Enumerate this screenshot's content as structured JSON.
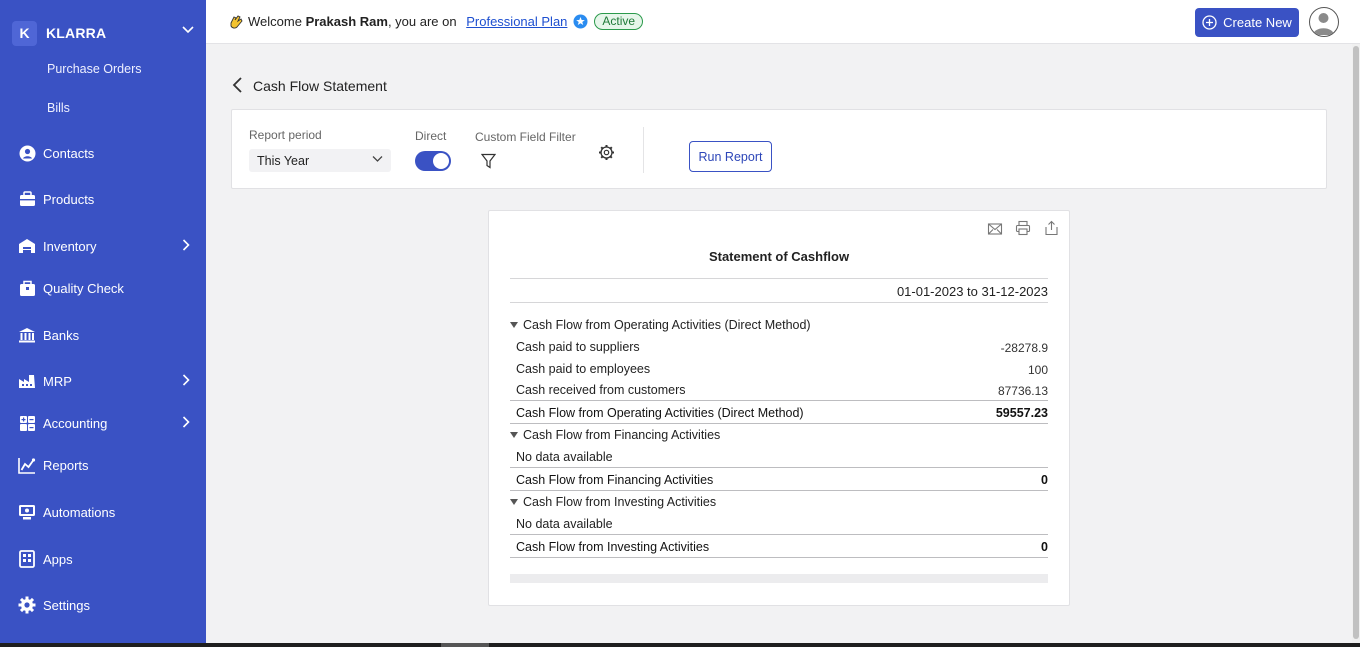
{
  "sidebar": {
    "org_initial": "K",
    "org_name": "KLARRA",
    "sub_items": [
      "Purchase Orders",
      "Bills"
    ],
    "items": [
      {
        "label": "Contacts",
        "icon": "contacts-icon"
      },
      {
        "label": "Products",
        "icon": "products-icon"
      },
      {
        "label": "Inventory",
        "icon": "inventory-icon",
        "has_children": true
      },
      {
        "label": "Quality Check",
        "icon": "quality-check-icon"
      },
      {
        "label": "Banks",
        "icon": "bank-icon"
      },
      {
        "label": "MRP",
        "icon": "factory-icon",
        "has_children": true
      },
      {
        "label": "Accounting",
        "icon": "accounting-icon",
        "has_children": true
      },
      {
        "label": "Reports",
        "icon": "reports-icon"
      },
      {
        "label": "Automations",
        "icon": "automations-icon"
      },
      {
        "label": "Apps",
        "icon": "apps-icon"
      },
      {
        "label": "Settings",
        "icon": "gear-icon"
      }
    ]
  },
  "topbar": {
    "welcome_prefix": "Welcome ",
    "user_name": "Prakash Ram",
    "welcome_suffix": ", you are on ",
    "plan": "Professional Plan",
    "status": "Active",
    "create_label": "Create New"
  },
  "page": {
    "title": "Cash Flow Statement"
  },
  "filters": {
    "period_label": "Report period",
    "period_value": "This Year",
    "direct_label": "Direct",
    "direct_on": true,
    "custom_filter_label": "Custom Field Filter",
    "run_label": "Run Report"
  },
  "report": {
    "title": "Statement of Cashflow",
    "date_range": "01-01-2023 to 31-12-2023",
    "sections": [
      {
        "heading": "Cash Flow from Operating Activities (Direct Method)",
        "rows": [
          {
            "label": "Cash paid to suppliers",
            "value": "-28278.9"
          },
          {
            "label": "Cash paid to employees",
            "value": "100"
          },
          {
            "label": "Cash received from customers",
            "value": "87736.13"
          }
        ],
        "total_label": "Cash Flow from Operating Activities (Direct Method)",
        "total_value": "59557.23"
      },
      {
        "heading": "Cash Flow from Financing Activities",
        "rows": [
          {
            "label": "No data available",
            "value": ""
          }
        ],
        "total_label": "Cash Flow from Financing Activities",
        "total_value": "0"
      },
      {
        "heading": "Cash Flow from Investing Activities",
        "rows": [
          {
            "label": "No data available",
            "value": ""
          }
        ],
        "total_label": "Cash Flow from Investing Activities",
        "total_value": "0"
      }
    ]
  },
  "colors": {
    "sidebar": "#3a52c4",
    "primary": "#3a52c4",
    "active_badge": "#2b9a4b",
    "link": "#1d4fd0"
  }
}
